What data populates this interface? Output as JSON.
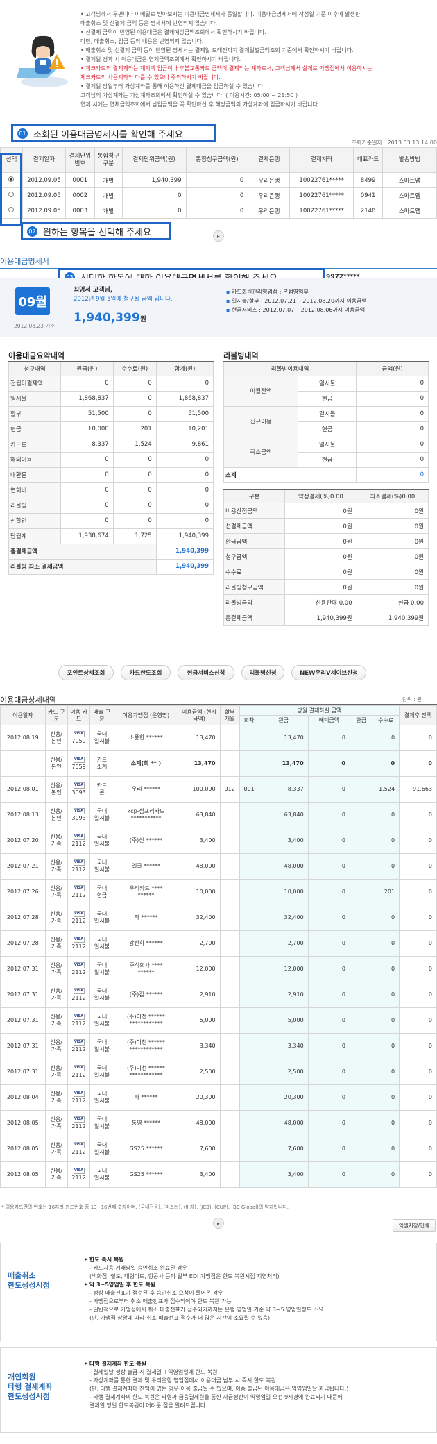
{
  "notice": {
    "lines": [
      "• 고객님께서 우편이나 이메일로 받아보시는 이용대금명세서와 동일합니다. 이용대금명세서에 작성일 기준 이후에 발생한",
      "  매출취소 및 선결제 금액 등은 명세서에 반영되지 않습니다.",
      "• 선결제 금액이 반영된 이용대금은 결제예상금액조회에서 확인하시기 바랍니다.",
      "  다만, 매출취소, 입금 등의 내용은 반영되지 않습니다.",
      "• 매출취소 및 선결제 금액 등이 반영된 명세서는 결제일 도래전까지 결제일별금액조회 기준에서 확인하시기 바랍니다.",
      "• 결제일 경과 시 이용대금은 연체금액조회에서 확인하시기 바랍니다.",
      "• 체크카드의 결제계좌는 재외택 입금이나 후불교통카드 금액이 결제되는 계좌로서, 고객님께서 실제로 가맹점에서 이용하시는",
      "  체크카드의 사용계좌와 다를 수 있으니 주의하시기 바랍니다.",
      "• 결제일 당일부터 가상계좌를 통해 이용하신 결제대금을 입금하실 수 있습니다.",
      "  고객님의 가상계좌는 가상계좌조회에서 확인하실 수 있습니다. ( 이용시간: 05:00 ~ 21:50 )",
      "  연체 시에는 연체금액조회에서 납입금액을 꼭 확인하신 후 해당금액의 가상계좌에 입금하시기 바랍니다."
    ]
  },
  "callouts": {
    "c1": {
      "num": "01",
      "text": "조회된 이용대금명세서를 확인해 주세요"
    },
    "c2": {
      "num": "02",
      "text": "원하는 항목을 선택해 주세요"
    },
    "c3": {
      "num": "03",
      "text": "선택한 항목에 대한 이용대금명세서를 확인해 주세요"
    }
  },
  "query": {
    "date_label": "조회기준일자 : 2013.03.13 14:00",
    "headers": [
      "선택",
      "결제일자",
      "결제단위\n번호",
      "통합청구\n구분",
      "결제단위금액(원)",
      "통합청구금액(원)",
      "결제은행",
      "결제계좌",
      "대표카드",
      "발송방법"
    ],
    "rows": [
      {
        "selected": true,
        "cells": [
          "2012.09.05",
          "0001",
          "개별",
          "1,940,399",
          "0",
          "우리은행",
          "10022761*****",
          "8499",
          "스마트앱"
        ]
      },
      {
        "selected": false,
        "cells": [
          "2012.09.05",
          "0002",
          "개별",
          "0",
          "0",
          "우리은행",
          "10022761*****",
          "0941",
          "스마트앱"
        ]
      },
      {
        "selected": false,
        "cells": [
          "2012.09.05",
          "0003",
          "개별",
          "0",
          "0",
          "우리은행",
          "10022761*****",
          "2148",
          "스마트앱"
        ]
      }
    ]
  },
  "statement": {
    "title": "이용대금명세서",
    "month": "09월",
    "base_date": "2012.08.23 기준",
    "customer": "최영서 고객님,",
    "claim_text": "2012년 9월 5일에 청구될 금액 입니다.",
    "amount": "1,940,399",
    "amount_unit": "원",
    "account_tail": "9972*****",
    "bullets": [
      "카드회원관리영업점 : 본점영업부",
      "일시불/할부 : 2012.07.21~ 2012.08.20까지 이용금액",
      "현금서비스 : 2012.07.07~ 2012.08.06까지 이용금액"
    ]
  },
  "summary": {
    "title": "이용대금요약내역",
    "headers": [
      "청구내역",
      "원금(원)",
      "수수료(원)",
      "합계(원)"
    ],
    "rows": [
      [
        "전월미결제액",
        "0",
        "0",
        "0"
      ],
      [
        "일시불",
        "1,868,837",
        "0",
        "1,868,837"
      ],
      [
        "할부",
        "51,500",
        "0",
        "51,500"
      ],
      [
        "현금",
        "10,000",
        "201",
        "10,201"
      ],
      [
        "카드론",
        "8,337",
        "1,524",
        "9,861"
      ],
      [
        "해외이용",
        "0",
        "0",
        "0"
      ],
      [
        "대환론",
        "0",
        "0",
        "0"
      ],
      [
        "연회비",
        "0",
        "0",
        "0"
      ],
      [
        "리볼빙",
        "0",
        "0",
        "0"
      ],
      [
        "선할인",
        "0",
        "0",
        "0"
      ],
      [
        "당월계",
        "1,938,674",
        "1,725",
        "1,940,399"
      ]
    ],
    "total_label": "총결제금액",
    "total_value": "1,940,399",
    "min_label": "리볼빙 최소 결제금액",
    "min_value": "1,940,399"
  },
  "revolving": {
    "title": "리볼빙내역",
    "headers": [
      "리볼빙이용내역",
      "금액(원)"
    ],
    "groups": [
      {
        "name": "이월잔액",
        "rows": [
          [
            "일시불",
            "0"
          ],
          [
            "현금",
            "0"
          ]
        ]
      },
      {
        "name": "신규이용",
        "rows": [
          [
            "일시불",
            "0"
          ],
          [
            "현금",
            "0"
          ]
        ]
      },
      {
        "name": "취소금액",
        "rows": [
          [
            "일시불",
            "0"
          ],
          [
            "현금",
            "0"
          ]
        ]
      }
    ],
    "subtotal_label": "소계",
    "subtotal_value": "0",
    "headers2": [
      "구분",
      "약정결제(%)0.00",
      "최소결제(%)0.00"
    ],
    "rows2": [
      [
        "비용산정금액",
        "0원",
        "0원"
      ],
      [
        "선결제금액",
        "0원",
        "0원"
      ],
      [
        "환급금액",
        "0원",
        "0원"
      ],
      [
        "청구금액",
        "0원",
        "0원"
      ],
      [
        "수수료",
        "0원",
        "0원"
      ],
      [
        "리볼빙청구금액",
        "0원",
        "0원"
      ],
      [
        "리볼빙금리",
        "신용판매 0.00",
        "현금 0.00"
      ],
      [
        "총결제금액",
        "1,940,399원",
        "1,940,399원"
      ]
    ]
  },
  "buttons": [
    "포인트상세조회",
    "카드한도조회",
    "현금서비스신청",
    "리볼빙신청",
    "NEW우리V세이브신청"
  ],
  "detail": {
    "title": "이용대금상세내역",
    "unit": "단위 : 원",
    "h_date": "이용일자",
    "h_card": "카드\n구분",
    "h_no": "이용\n카드",
    "h_type": "매출\n구분",
    "h_merchant": "이용가맹점\n(은행명)",
    "h_amount": "이용금액\n(현지금액)",
    "h_months": "할부\n개월",
    "h_current": "당월 결제하실 금액",
    "h_round": "회차",
    "h_principal": "원금",
    "h_benefit": "혜택금액",
    "h_refund": "환급",
    "h_fee": "수수료",
    "h_balance": "결제후\n잔액",
    "rows": [
      [
        "2012.08.19",
        "신용/\n본인",
        "7059",
        "국내\n일시불",
        "소풍한 ******",
        "13,470",
        "",
        "",
        "13,470",
        "0",
        "",
        "0",
        "0"
      ],
      [
        "",
        "신용/\n본인",
        "7059",
        "카드\n소계",
        "소계(최 ** )",
        "13,470",
        "",
        "",
        "13,470",
        "0",
        "",
        "0",
        "0"
      ],
      [
        "2012.08.01",
        "신용/\n본인",
        "3093",
        "카드\n론",
        "우리 ******",
        "100,000",
        "012",
        "001",
        "8,337",
        "0",
        "",
        "1,524",
        "91,663"
      ],
      [
        "2012.08.13",
        "신용/\n본인",
        "3093",
        "국내\n일시불",
        "kcp-삼프리카드\n***********",
        "63,840",
        "",
        "",
        "63,840",
        "0",
        "",
        "0",
        "0"
      ],
      [
        "2012.07.20",
        "신용/\n가족",
        "2112",
        "국내\n일시불",
        "(주)신 ******",
        "3,400",
        "",
        "",
        "3,400",
        "0",
        "",
        "0",
        "0"
      ],
      [
        "2012.07.21",
        "신용/\n가족",
        "2112",
        "국내\n일시불",
        "엘골 ******",
        "48,000",
        "",
        "",
        "48,000",
        "0",
        "",
        "0",
        "0"
      ],
      [
        "2012.07.26",
        "신용/\n가족",
        "2112",
        "국내\n현금",
        "우리카드 ****\n******",
        "10,000",
        "",
        "",
        "10,000",
        "0",
        "",
        "201",
        "0"
      ],
      [
        "2012.07.28",
        "신용/\n가족",
        "2112",
        "국내\n일시불",
        "파 ******",
        "32,400",
        "",
        "",
        "32,400",
        "0",
        "",
        "0",
        "0"
      ],
      [
        "2012.07.28",
        "신용/\n가족",
        "2112",
        "국내\n일시불",
        "강산하 ******",
        "2,700",
        "",
        "",
        "2,700",
        "0",
        "",
        "0",
        "0"
      ],
      [
        "2012.07.31",
        "신용/\n가족",
        "2112",
        "국내\n일시불",
        "주식회사 ****\n******",
        "12,000",
        "",
        "",
        "12,000",
        "0",
        "",
        "0",
        "0"
      ],
      [
        "2012.07.31",
        "신용/\n가족",
        "2112",
        "국내\n일시불",
        "(주)킴 ******",
        "2,910",
        "",
        "",
        "2,910",
        "0",
        "",
        "0",
        "0"
      ],
      [
        "2012.07.31",
        "신용/\n가족",
        "2112",
        "국내\n일시불",
        "(주)이천 ******\n************",
        "5,000",
        "",
        "",
        "5,000",
        "0",
        "",
        "0",
        "0"
      ],
      [
        "2012.07.31",
        "신용/\n가족",
        "2112",
        "국내\n일시불",
        "(주)이천 ******\n************",
        "3,340",
        "",
        "",
        "3,340",
        "0",
        "",
        "0",
        "0"
      ],
      [
        "2012.07.31",
        "신용/\n가족",
        "2112",
        "국내\n일시불",
        "(주)이천 ******\n************",
        "2,500",
        "",
        "",
        "2,500",
        "0",
        "",
        "0",
        "0"
      ],
      [
        "2012.08.04",
        "신용/\n가족",
        "2112",
        "국내\n일시불",
        "파 ******",
        "20,300",
        "",
        "",
        "20,300",
        "0",
        "",
        "0",
        "0"
      ],
      [
        "2012.08.05",
        "신용/\n가족",
        "2112",
        "국내\n일시불",
        "통영 ******",
        "48,000",
        "",
        "",
        "48,000",
        "0",
        "",
        "0",
        "0"
      ],
      [
        "2012.08.05",
        "신용/\n가족",
        "2112",
        "국내\n일시불",
        "GS25 ******",
        "7,600",
        "",
        "",
        "7,600",
        "0",
        "",
        "0",
        "0"
      ],
      [
        "2012.08.05",
        "신용/\n가족",
        "2112",
        "국내\n일시불",
        "GS25 ******",
        "3,400",
        "",
        "",
        "3,400",
        "0",
        "",
        "0",
        "0"
      ]
    ],
    "card_brand": "VISA"
  },
  "footnote": "* 이용카드란의 번호는 16자리 카드번호 중 13~16번째 숫자이며, (국내전용), (마스터), (비자), (JCB), (CUP), (BC Global)의 약자입니다.",
  "excel_button": "엑셀저장/인쇄",
  "box1": {
    "label": [
      "매출취소",
      "한도생성시점"
    ],
    "items": [
      {
        "t": "h",
        "s": "• 한도 즉시 복원"
      },
      {
        "t": "s",
        "s": "- 카드사용 거래당일 승인취소 완료된 경우"
      },
      {
        "t": "s",
        "s": "(백화점, 철도, 대형마트, 항공사 등의 일부 EDI 가맹점은 한도 복원시점 지연처리)"
      },
      {
        "t": "h",
        "s": "• 약 3~5영업일 후 한도 복원"
      },
      {
        "t": "s",
        "s": "- 정상 매출전표가 접수된 후 승인취소 요청이 들어온 경우"
      },
      {
        "t": "s",
        "s": "- 가맹점으로부터 취소 매출전표가 접수되어야 한도 복원 가능"
      },
      {
        "t": "s",
        "s": "- 일반적으로 가맹점에서 취소 매출전표가 접수되기까지는 은행 영업일 기준 약 3~5 영업일정도 소요"
      },
      {
        "t": "s",
        "s": "(단, 가맹점 상황에 따라 취소 매출전표 접수가 더 많은 시간이 소요될 수 있음)"
      }
    ]
  },
  "box2": {
    "label": [
      "개인회원",
      "타행 결제계좌",
      "한도생성시점"
    ],
    "items": [
      {
        "t": "h",
        "s": "• 타행 결제계좌 한도 복원"
      },
      {
        "t": "s",
        "s": "- 결제일날 정상 출금 시 결제일 +익영업일에 한도 복원"
      },
      {
        "t": "s",
        "s": "- 가상계좌를 통한 결제 및 우리은행 영업점에서 이용대금 납부 시 즉시 한도 복원"
      },
      {
        "t": "s",
        "s": "(단, 타행 결제계좌에 잔액이 있는 경우 이용 출금될 수 있으며, 이중 출금된 이용대금은 익영업일날 환급됩니다.)"
      },
      {
        "t": "s",
        "s": "- 타행 결제계좌의 한도 복원은 타행과 금융결제원을 통한 자금정산이 익영업일 오전 9시경에 완료되기 때문에"
      },
      {
        "t": "s",
        "s": "결제일 당일 한도복원이 어려운 점을 알려드립니다."
      }
    ]
  }
}
